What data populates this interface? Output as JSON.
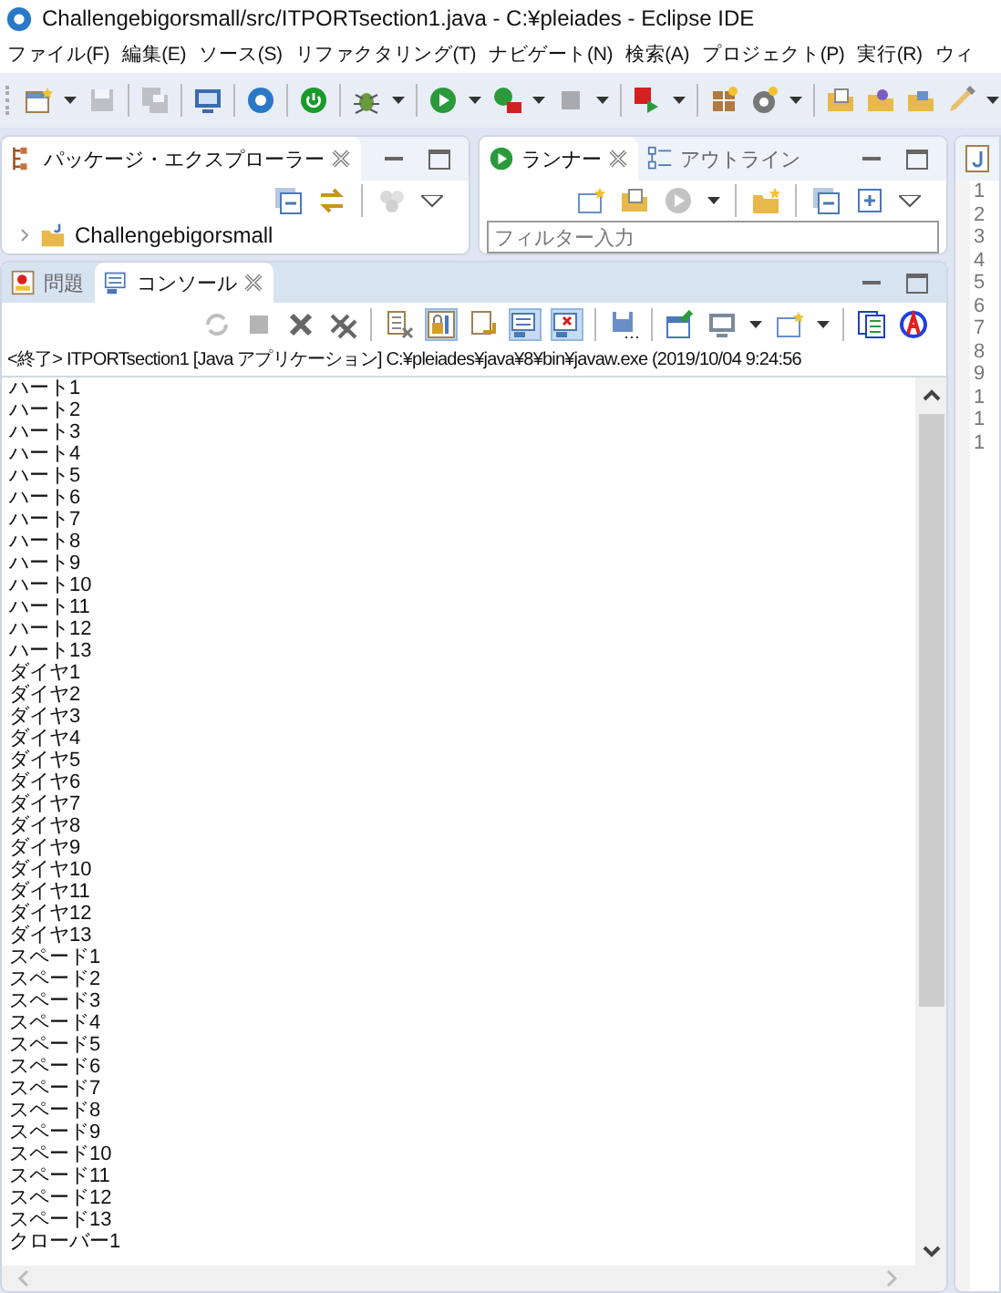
{
  "window": {
    "title": "Challengebigorsmall/src/ITPORTsection1.java - C:¥pleiades - Eclipse IDE"
  },
  "menu": [
    "ファイル(F)",
    "編集(E)",
    "ソース(S)",
    "リファクタリング(T)",
    "ナビゲート(N)",
    "検索(A)",
    "プロジェクト(P)",
    "実行(R)",
    "ウィ"
  ],
  "toolbar": [
    {
      "disabled": false
    },
    {
      "disabled": true
    },
    {
      "disabled": true
    },
    {
      "disabled": false
    },
    {
      "disabled": false
    },
    {
      "disabled": false
    },
    {
      "disabled": false
    },
    {
      "disabled": false
    },
    {
      "disabled": false
    },
    {
      "disabled": true
    },
    {
      "disabled": false
    },
    {
      "disabled": false
    },
    {
      "disabled": false
    },
    {
      "disabled": false
    },
    {
      "disabled": false
    },
    {
      "disabled": false
    },
    {
      "disabled": false
    }
  ],
  "package_explorer": {
    "tabs": [
      {
        "label": "パッケージ・エクスプローラー",
        "selected": true
      }
    ],
    "tree": [
      {
        "label": "Challengebigorsmall",
        "expanded": false
      }
    ]
  },
  "runner": {
    "tabs": [
      {
        "label": "ランナー",
        "selected": true
      },
      {
        "label": "アウトライン",
        "selected": false
      }
    ],
    "filter": {
      "placeholder": "フィルター入力"
    }
  },
  "console": {
    "tabs": [
      {
        "label": "問題",
        "selected": false
      },
      {
        "label": "コンソール",
        "selected": true
      }
    ],
    "tools": [
      {
        "disabled": true,
        "pressed": false
      },
      {
        "disabled": true,
        "pressed": false
      },
      {
        "disabled": false,
        "pressed": false
      },
      {
        "disabled": false,
        "pressed": false
      },
      {
        "disabled": false,
        "pressed": false
      },
      {
        "disabled": false,
        "pressed": true
      },
      {
        "disabled": false,
        "pressed": false
      },
      {
        "disabled": false,
        "pressed": true
      },
      {
        "disabled": false,
        "pressed": true
      },
      {
        "disabled": false,
        "pressed": false
      },
      {
        "disabled": false,
        "pressed": false
      },
      {
        "disabled": false,
        "pressed": false
      },
      {
        "disabled": false,
        "pressed": false
      },
      {
        "disabled": false,
        "pressed": false
      },
      {
        "disabled": false,
        "pressed": false
      }
    ],
    "status": "<終了> ITPORTsection1 [Java アプリケーション] C:¥pleiades¥java¥8¥bin¥javaw.exe (2019/10/04 9:24:56",
    "lines": [
      "ハート1",
      "ハート2",
      "ハート3",
      "ハート4",
      "ハート5",
      "ハート6",
      "ハート7",
      "ハート8",
      "ハート9",
      "ハート10",
      "ハート11",
      "ハート12",
      "ハート13",
      "ダイヤ1",
      "ダイヤ2",
      "ダイヤ3",
      "ダイヤ4",
      "ダイヤ5",
      "ダイヤ6",
      "ダイヤ7",
      "ダイヤ8",
      "ダイヤ9",
      "ダイヤ10",
      "ダイヤ11",
      "ダイヤ12",
      "ダイヤ13",
      "スペード1",
      "スペード2",
      "スペード3",
      "スペード4",
      "スペード5",
      "スペード6",
      "スペード7",
      "スペード8",
      "スペード9",
      "スペード10",
      "スペード11",
      "スペード12",
      "スペード13",
      "クローバー1"
    ]
  },
  "editor": {
    "line_numbers": [
      "1",
      "2",
      "3",
      "4",
      "5",
      "6",
      "7",
      "8",
      "9",
      "1",
      "1",
      "1"
    ]
  }
}
